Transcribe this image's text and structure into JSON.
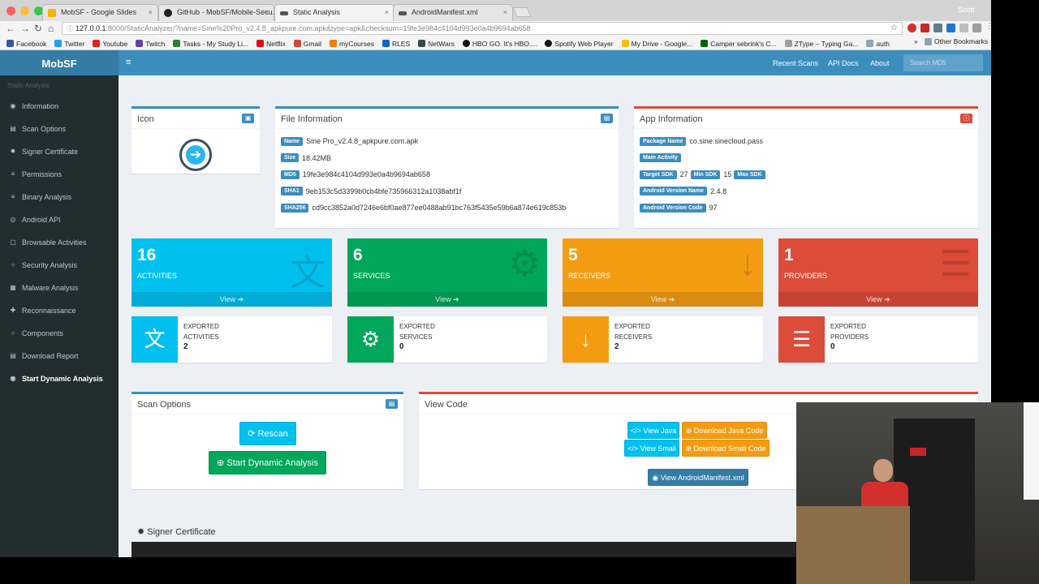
{
  "browser": {
    "tabs": [
      {
        "label": "MobSF - Google Slides",
        "close": "×",
        "color": "#f4b400"
      },
      {
        "label": "GitHub - MobSF/Mobile-Secu...",
        "close": "×",
        "color": "#222222"
      },
      {
        "label": "Static Analysis",
        "close": "×",
        "color": "#555555"
      },
      {
        "label": "AndroidManifest.xml",
        "close": "×",
        "color": "#555555"
      }
    ],
    "user": "Scott",
    "url_host": "127.0.0.1",
    "url_rest": ":8000/StaticAnalyzer/?name=Sine%20Pro_v2.4.8_apkpure.com.apk&type=apk&checksum=19fe3e984c4104d993e0a4b9694ab658",
    "bookmarks": [
      "Facebook",
      "Twitter",
      "Youtube",
      "Twitch",
      "Tasks - My Study Li...",
      "Netflix",
      "Gmail",
      "myCourses",
      "RLES",
      "NetWars",
      "HBO GO. It's HBO....",
      "Spotify Web Player",
      "My Drive - Google...",
      "Camper sebrink's C...",
      "ZType – Typing Ga...",
      "auth"
    ],
    "other_bookmarks": "Other Bookmarks",
    "more": "»"
  },
  "sidebar": {
    "logo": "MobSF",
    "header": "Static Analysis",
    "items": [
      {
        "label": "Information",
        "icon": "◉"
      },
      {
        "label": "Scan Options",
        "icon": "▤"
      },
      {
        "label": "Signer Certificate",
        "icon": "✹"
      },
      {
        "label": "Permissions",
        "icon": "≡"
      },
      {
        "label": "Binary Analysis",
        "icon": "≡"
      },
      {
        "label": "Android API",
        "icon": "◎"
      },
      {
        "label": "Browsable Activities",
        "icon": "▢"
      },
      {
        "label": "Security Analysis",
        "icon": "○"
      },
      {
        "label": "Malware Analysis",
        "icon": "▦"
      },
      {
        "label": "Reconnaissance",
        "icon": "✚"
      },
      {
        "label": "Components",
        "icon": "○"
      },
      {
        "label": "Download Report",
        "icon": "▤"
      },
      {
        "label": "Start Dynamic Analysis",
        "icon": "◉"
      }
    ]
  },
  "topnav": {
    "menu_icon": "≡",
    "links": [
      "Recent Scans",
      "API Docs",
      "About"
    ],
    "search_placeholder": "Search MD5"
  },
  "icon_box": {
    "title": "Icon"
  },
  "file_info": {
    "title": "File Information",
    "rows": [
      {
        "label": "Name",
        "value": "Sine Pro_v2.4.8_apkpure.com.apk"
      },
      {
        "label": "Size",
        "value": "18.42MB"
      },
      {
        "label": "MD5",
        "value": "19fe3e984c4104d993e0a4b9694ab658"
      },
      {
        "label": "SHA1",
        "value": "9eb153c5d3399b0cb4bfe735966312a1038abf1f"
      },
      {
        "label": "SHA256",
        "value": "cd9cc3852a0d7246e6bf0ae877ee0488ab91bc763f5435e59b6a874e619c853b"
      }
    ]
  },
  "app_info": {
    "title": "App Information",
    "package_label": "Package Name",
    "package_value": "co.sine.sinecloud.pass",
    "main_activity_label": "Main Activity",
    "target_sdk_label": "Target SDK",
    "target_sdk": "27",
    "min_sdk_label": "Min SDK",
    "min_sdk": "15",
    "max_sdk_label": "Max SDK",
    "version_name_label": "Android Version Name",
    "version_name": "2.4.8",
    "version_code_label": "Android Version Code",
    "version_code": "97"
  },
  "stats": [
    {
      "count": "16",
      "label": "ACTIVITIES",
      "view": "View ➔",
      "color": "#00c0ef",
      "exported_line1": "EXPORTED",
      "exported_line2": "ACTIVITIES",
      "exported": "2"
    },
    {
      "count": "6",
      "label": "SERVICES",
      "view": "View ➔",
      "color": "#00a65a",
      "exported_line1": "EXPORTED",
      "exported_line2": "SERVICES",
      "exported": "0"
    },
    {
      "count": "5",
      "label": "RECEIVERS",
      "view": "View ➔",
      "color": "#f39c12",
      "exported_line1": "EXPORTED",
      "exported_line2": "RECEIVERS",
      "exported": "2"
    },
    {
      "count": "1",
      "label": "PROVIDERS",
      "view": "View ➔",
      "color": "#dd4b39",
      "exported_line1": "EXPORTED",
      "exported_line2": "PROVIDERS",
      "exported": "0"
    }
  ],
  "scan_options": {
    "title": "Scan Options",
    "rescan": "⟳ Rescan",
    "dynamic": "⊕ Start Dynamic Analysis"
  },
  "view_code": {
    "title": "View Code",
    "view_java": "</> View Java",
    "download_java": "⊕ Download Java Code",
    "view_smali": "</> View Smali",
    "download_smali": "⊕ Download Smali Code",
    "view_manifest": "◉ View AndroidManifest.xml"
  },
  "signer": {
    "title": "✹ Signer Certificate"
  }
}
